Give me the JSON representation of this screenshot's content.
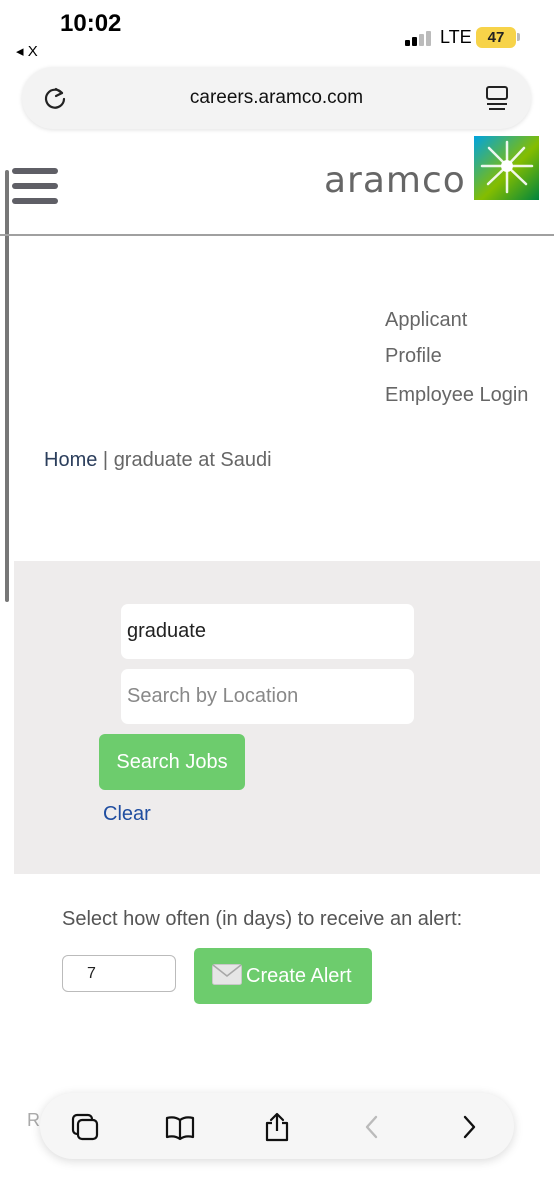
{
  "status_bar": {
    "time": "10:02",
    "back_app": "◂ X",
    "network": "LTE",
    "battery": "47"
  },
  "browser": {
    "url": "careers.aramco.com",
    "reload_icon": "reload-icon",
    "reader_icon": "reader-icon"
  },
  "header": {
    "menu_icon": "hamburger-menu-icon",
    "logo_text": "aramco",
    "logo_mark_colors": [
      "#00a3e0",
      "#84bd00",
      "#00843d"
    ]
  },
  "nav_links": {
    "applicant": "Applicant",
    "profile": "Profile",
    "employee_login": "Employee Login"
  },
  "breadcrumb": {
    "home": "Home",
    "separator": "|",
    "current": "graduate at Saudi"
  },
  "search": {
    "keyword_value": "graduate",
    "location_placeholder": "Search by Location",
    "search_button": "Search Jobs",
    "clear_link": "Clear"
  },
  "alert": {
    "label": "Select how often (in days) to receive an alert:",
    "days_value": "7",
    "create_button": "Create Alert"
  },
  "partial_text": "R",
  "toolbar": {
    "icons": [
      "tabs-icon",
      "bookmarks-icon",
      "share-icon",
      "back-icon",
      "forward-icon"
    ]
  },
  "colors": {
    "button_green": "#6dcc6d",
    "link_blue": "#1f4da0",
    "panel_gray": "#eeecec"
  }
}
